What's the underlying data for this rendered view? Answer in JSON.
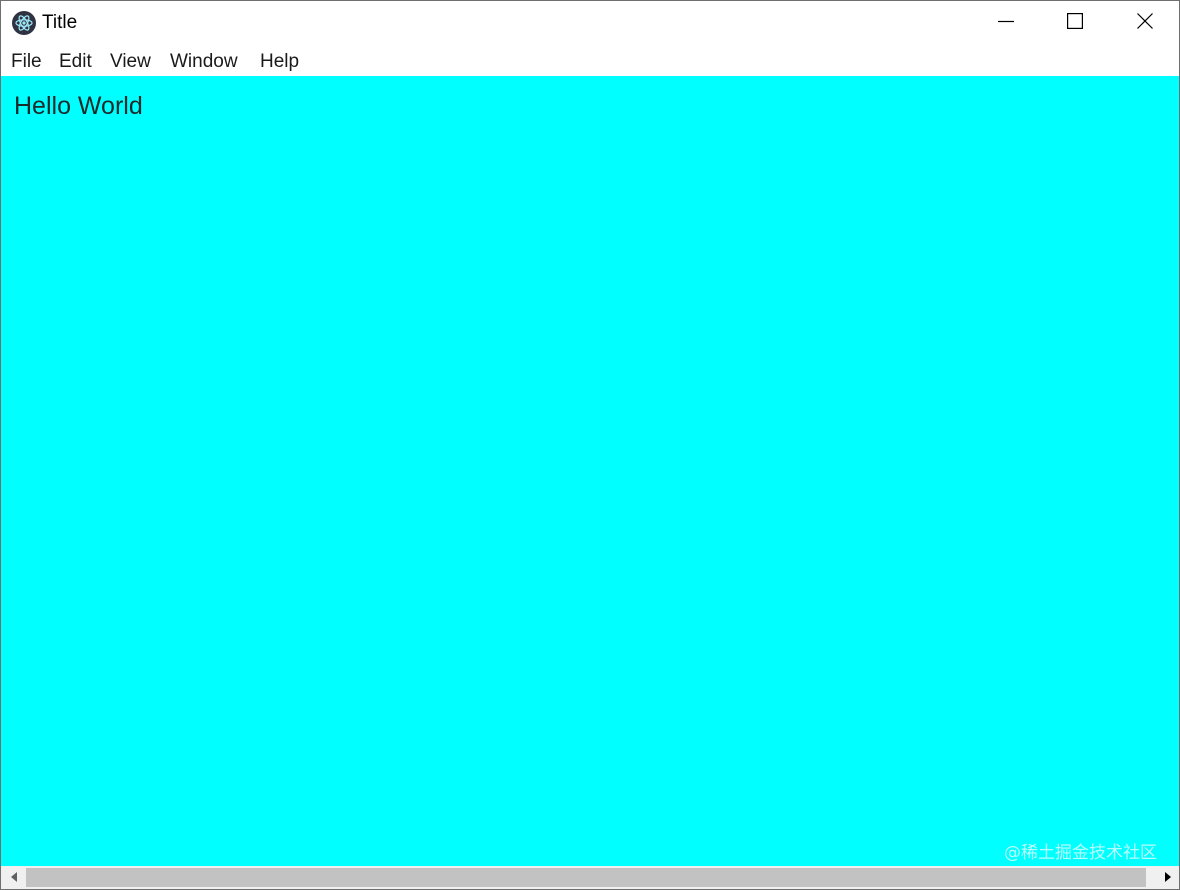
{
  "window": {
    "title": "Title",
    "app_icon": "electron-atom-icon",
    "controls": {
      "minimize_icon": "minimize-icon",
      "maximize_icon": "maximize-icon",
      "close_icon": "close-icon"
    }
  },
  "menubar": {
    "items": [
      {
        "label": "File"
      },
      {
        "label": "Edit"
      },
      {
        "label": "View"
      },
      {
        "label": "Window"
      },
      {
        "label": "Help"
      }
    ]
  },
  "content": {
    "text": "Hello World",
    "background_color": "#00ffff"
  },
  "watermark": {
    "text": "@稀土掘金技术社区"
  },
  "scrollbar": {
    "orientation": "horizontal",
    "left_arrow_icon": "scroll-left-icon",
    "right_arrow_icon": "scroll-right-icon"
  }
}
